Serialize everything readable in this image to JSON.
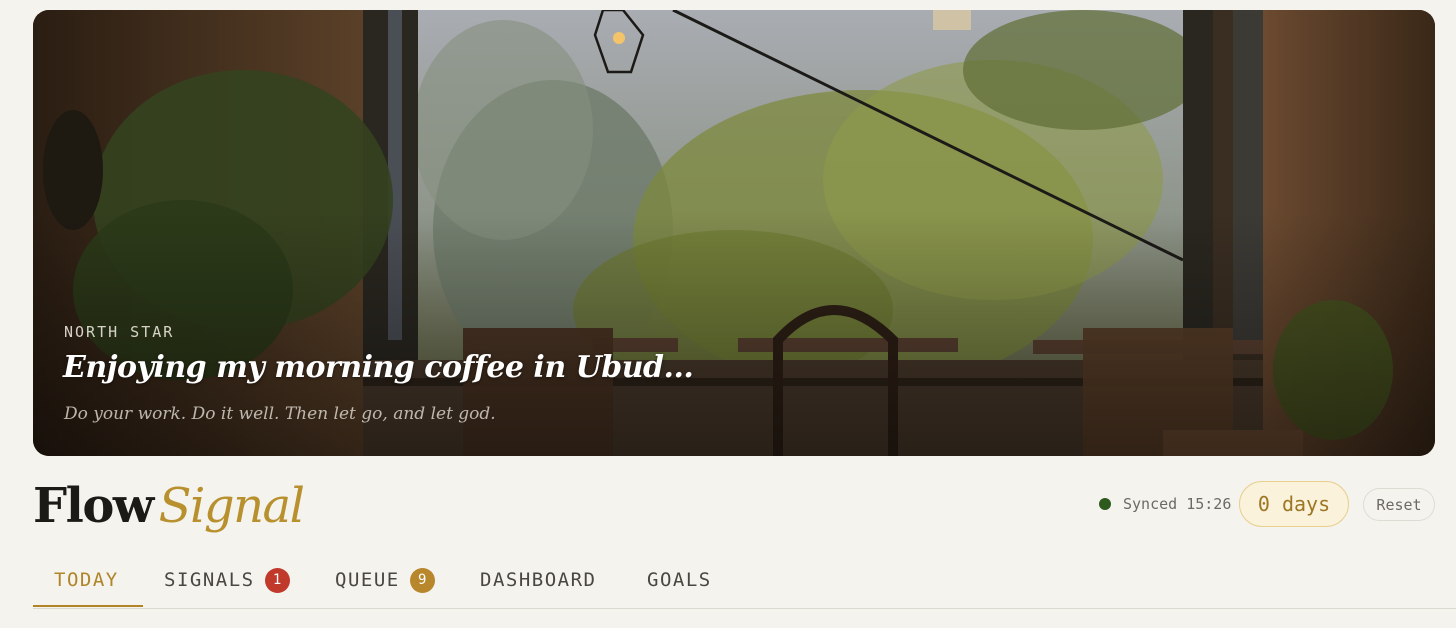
{
  "hero": {
    "eyebrow": "NORTH STAR",
    "title": "Enjoying my morning coffee in Ubud...",
    "quote": "Do your work. Do it well. Then let go, and let god."
  },
  "brand": {
    "word1": "Flow",
    "word2": "Signal"
  },
  "status": {
    "sync_text": "Synced 15:26",
    "sync_color": "#2e5a1e",
    "days_label": "0 days",
    "reset_label": "Reset"
  },
  "tabs": [
    {
      "label": "TODAY",
      "active": true
    },
    {
      "label": "SIGNALS",
      "badge": "1",
      "badge_color": "#c0392b"
    },
    {
      "label": "QUEUE",
      "badge": "9",
      "badge_color": "#b8862b"
    },
    {
      "label": "DASHBOARD"
    },
    {
      "label": "GOALS"
    }
  ],
  "colors": {
    "accent": "#b08427",
    "background": "#f4f3ee"
  }
}
